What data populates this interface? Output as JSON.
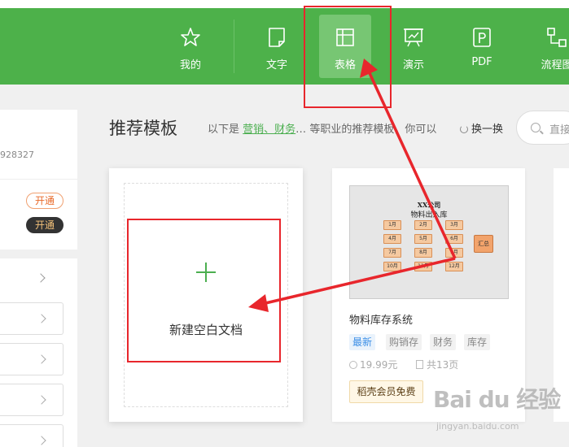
{
  "nav": {
    "items": [
      {
        "label": "我的",
        "icon": "star-icon"
      },
      {
        "label": "文字",
        "icon": "document-icon"
      },
      {
        "label": "表格",
        "icon": "table-icon"
      },
      {
        "label": "演示",
        "icon": "presentation-icon"
      },
      {
        "label": "PDF",
        "icon": "pdf-icon"
      },
      {
        "label": "流程图",
        "icon": "flowchart-icon"
      }
    ],
    "active_label": "表格",
    "bar_color": "#4db14a"
  },
  "left_panel": {
    "account_id": "928327",
    "open_buttons": [
      "开通",
      "开通"
    ]
  },
  "section": {
    "title": "推荐模板",
    "subtitle_prefix": "以下是",
    "subtitle_links": "营销、财务",
    "subtitle_ellipsis": "…",
    "subtitle_suffix": "等职业的推荐模板，你可以",
    "refresh_label": "换一换",
    "search_placeholder": "直接"
  },
  "blank_card": {
    "label": "新建空白文档"
  },
  "template_card": {
    "thumb_company": "XX公司",
    "thumb_title": "物料出入库",
    "months": [
      "1月",
      "2月",
      "3月",
      "4月",
      "5月",
      "6月",
      "7月",
      "8月",
      "9月",
      "10月",
      "11月",
      "12月"
    ],
    "summary": "汇总",
    "name": "物料库存系统",
    "tags": [
      "最新",
      "购销存",
      "财务",
      "库存"
    ],
    "price": "19.99元",
    "pages": "共13页",
    "free_badge": "稻壳会员免费"
  },
  "watermark": {
    "brand": "Bai du 经验",
    "url": "jingyan.baidu.com"
  },
  "annotation_color": "#e8262c"
}
